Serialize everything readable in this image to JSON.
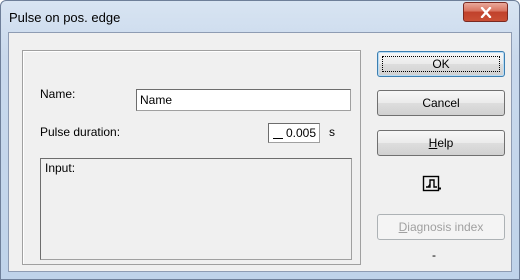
{
  "window": {
    "title": "Pulse on pos. edge"
  },
  "form": {
    "name_label": "Name:",
    "name_value": "Name",
    "pulse_label": "Pulse duration:",
    "pulse_value": "0.005",
    "pulse_unit": "s",
    "input_label": "Input:"
  },
  "buttons": {
    "ok": "OK",
    "cancel": "Cancel",
    "help_prefix": "",
    "help_mnemonic": "H",
    "help_suffix": "elp",
    "diag_mnemonic": "D",
    "diag_suffix": "iagnosis index"
  },
  "status": {
    "diag_value": "-"
  },
  "icons": {
    "close": "close-icon",
    "pulse": "pulse-symbol-icon"
  }
}
